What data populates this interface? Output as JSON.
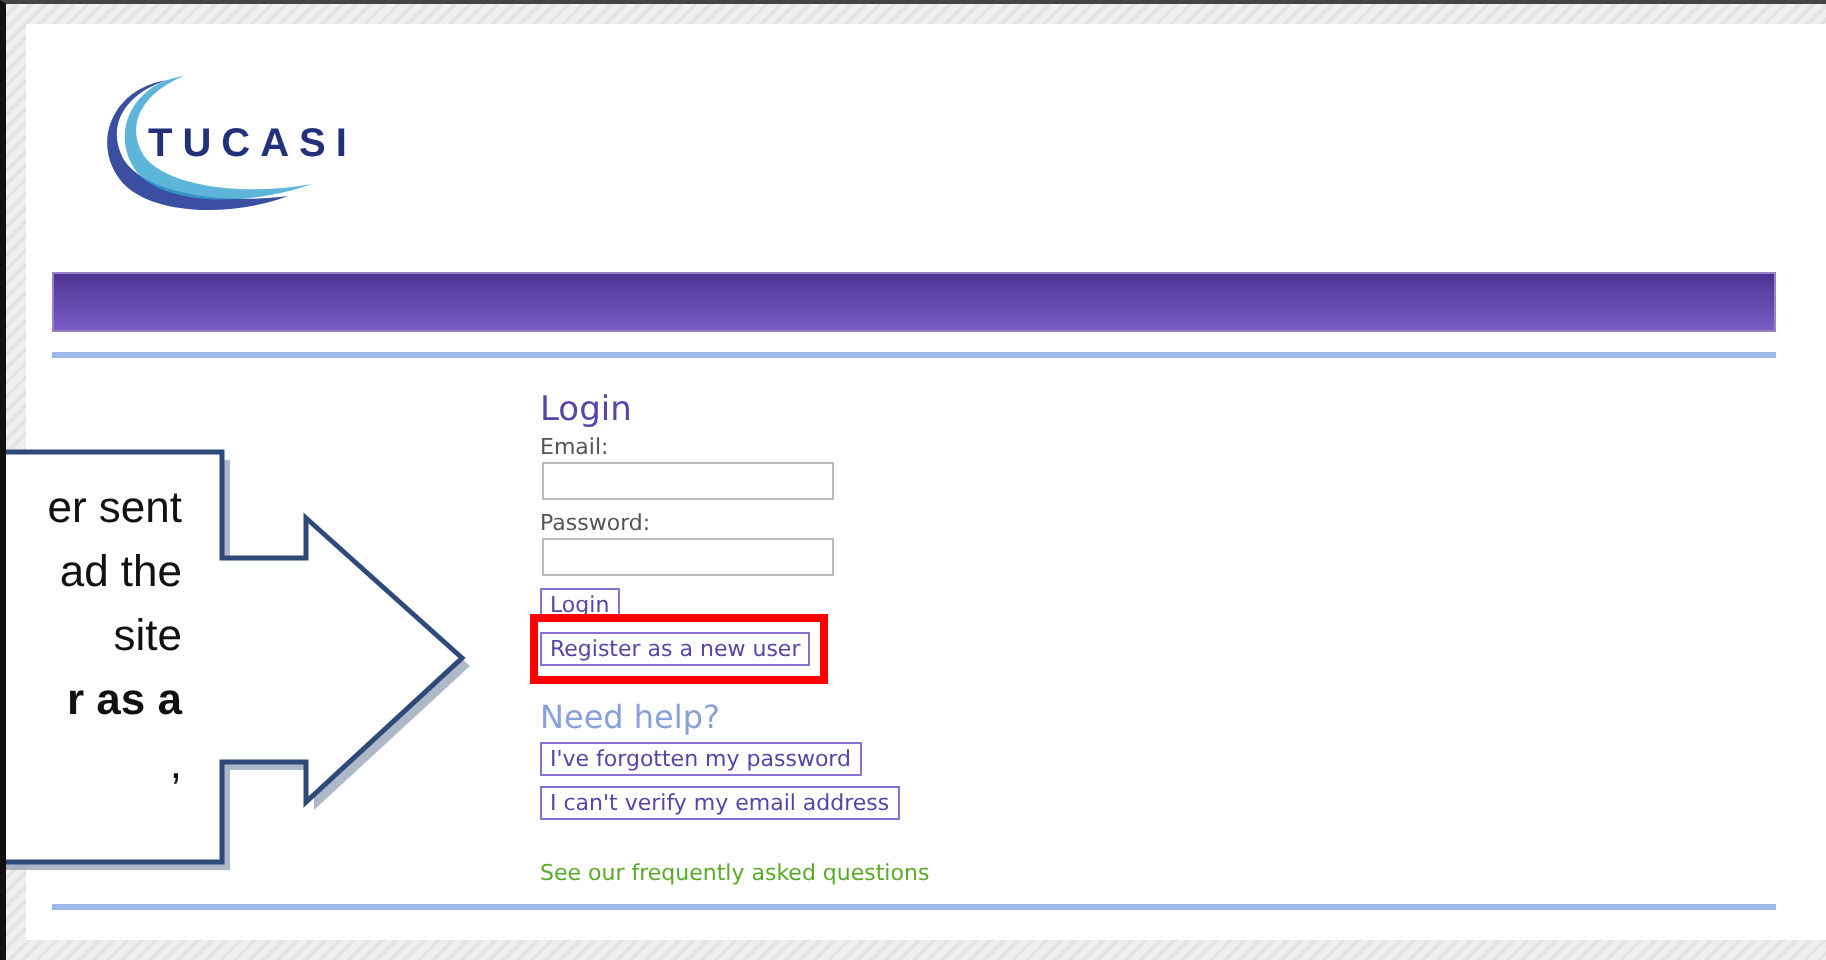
{
  "logo": {
    "text": "TUCASI"
  },
  "login": {
    "title": "Login",
    "fields": [
      {
        "label": "Email:"
      },
      {
        "label": "Password:"
      }
    ],
    "login_button": "Login",
    "register_button": {
      "label": "Register as a new user",
      "highlighted": true
    }
  },
  "help": {
    "title": "Need help?",
    "buttons": [
      "I've forgotten my password",
      "I can't verify my email address"
    ],
    "faq_link": "See our frequently asked questions"
  },
  "callout": {
    "text": "er sent\nad the\nsite\n**r as a**\n,"
  }
}
